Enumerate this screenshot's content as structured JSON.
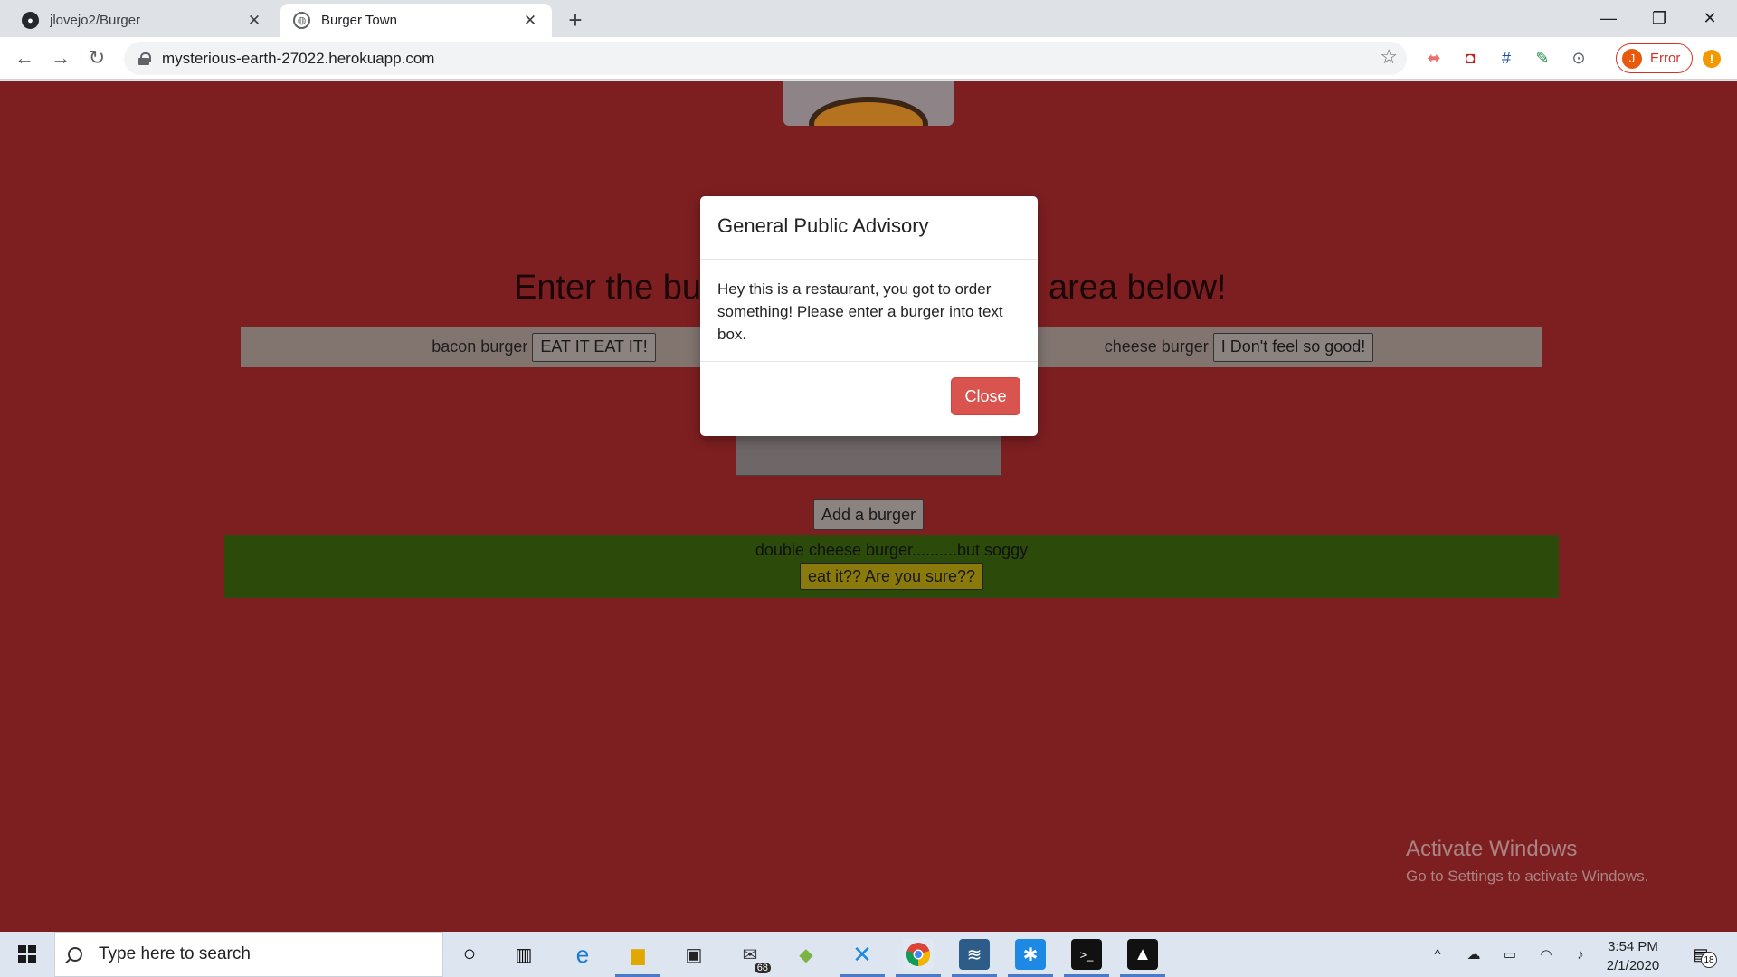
{
  "browser": {
    "tabs": [
      {
        "title": "jlovejo2/Burger",
        "icon": "github-icon"
      },
      {
        "title": "Burger Town",
        "icon": "globe-icon"
      }
    ],
    "url": "mysterious-earth-27022.herokuapp.com",
    "profile_label": "Error",
    "profile_initial": "J"
  },
  "page": {
    "headline_left": "Enter the bu",
    "headline_right": "area below!",
    "uneaten": [
      {
        "name": "bacon burger",
        "button": "EAT IT EAT IT!"
      },
      {
        "name": "cheese burger",
        "button": "I Don't feel so good!"
      }
    ],
    "add_button": "Add a burger",
    "devoured": {
      "name": "double cheese burger..........but soggy",
      "button": "eat it?? Are you sure??"
    },
    "colors": {
      "background": "#7d1f21",
      "devoured_bar": "#2c4a0a",
      "modal_close": "#d9534f"
    }
  },
  "modal": {
    "title": "General Public Advisory",
    "body": "Hey this is a restaurant, you got to order something! Please enter a burger into text box.",
    "close": "Close"
  },
  "watermark": {
    "line1": "Activate Windows",
    "line2": "Go to Settings to activate Windows."
  },
  "taskbar": {
    "search_placeholder": "Type here to search",
    "mail_badge": "68",
    "time": "3:54 PM",
    "date": "2/1/2020",
    "notification_count": "18"
  }
}
